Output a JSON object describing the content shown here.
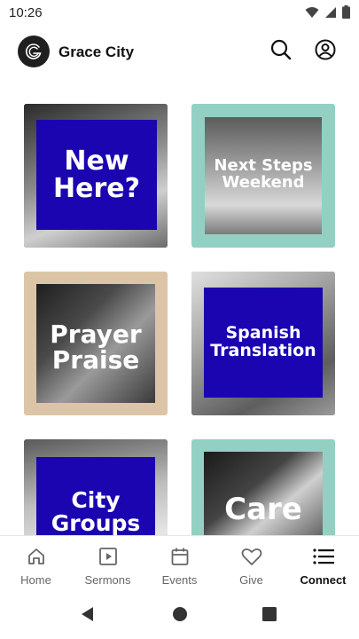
{
  "status_bar": {
    "time": "10:26",
    "icons": [
      "wifi-icon",
      "cellular-signal-icon",
      "battery-icon"
    ]
  },
  "header": {
    "app_name": "Grace City",
    "logo_icon": "grace-city-logo-icon",
    "actions": [
      "search-icon",
      "account-icon"
    ]
  },
  "tiles": [
    {
      "label": "New Here?",
      "frame_color": "#444444",
      "overlay_color": "#1a05b0"
    },
    {
      "label": "Next Steps Weekend",
      "frame_color": "#93d0c4"
    },
    {
      "label": "Prayer Praise",
      "frame_color": "#dcc5a6"
    },
    {
      "label": "Spanish Translation",
      "frame_color": "#777777",
      "overlay_color": "#1a05b0"
    },
    {
      "label": "City Groups",
      "frame_color": "#888888",
      "overlay_color": "#1a05b0"
    },
    {
      "label": "Care",
      "frame_color": "#93d0c4"
    }
  ],
  "bottom_nav": {
    "items": [
      {
        "label": "Home",
        "icon": "home-icon",
        "active": false
      },
      {
        "label": "Sermons",
        "icon": "play-square-icon",
        "active": false
      },
      {
        "label": "Events",
        "icon": "calendar-icon",
        "active": false
      },
      {
        "label": "Give",
        "icon": "heart-icon",
        "active": false
      },
      {
        "label": "Connect",
        "icon": "list-icon",
        "active": true
      }
    ]
  },
  "system_nav": [
    "back-icon",
    "home-circle-icon",
    "recents-icon"
  ],
  "colors": {
    "accent_blue": "#1a05b0",
    "teal_frame": "#93d0c4",
    "tan_frame": "#dcc5a6",
    "text_dark": "#111111",
    "text_muted": "#666666"
  }
}
